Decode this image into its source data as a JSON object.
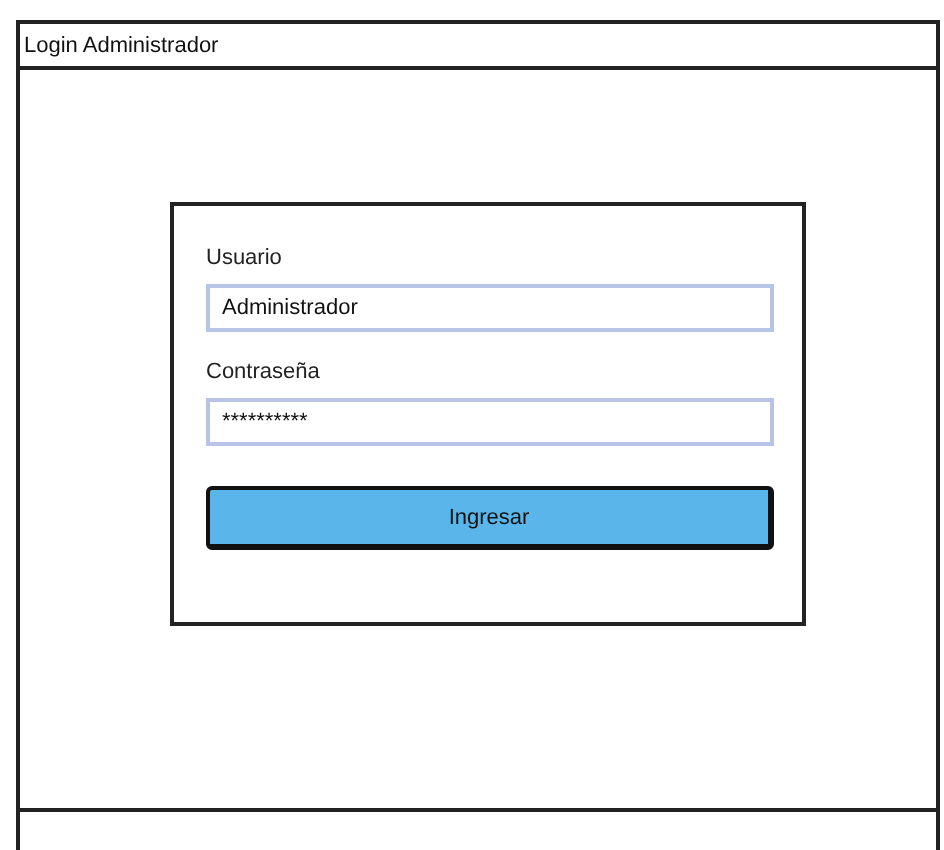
{
  "window": {
    "title": "Login Administrador"
  },
  "form": {
    "username": {
      "label": "Usuario",
      "value": "Administrador"
    },
    "password": {
      "label": "Contraseña",
      "value": "**********"
    },
    "submit": {
      "label": "Ingresar"
    }
  }
}
